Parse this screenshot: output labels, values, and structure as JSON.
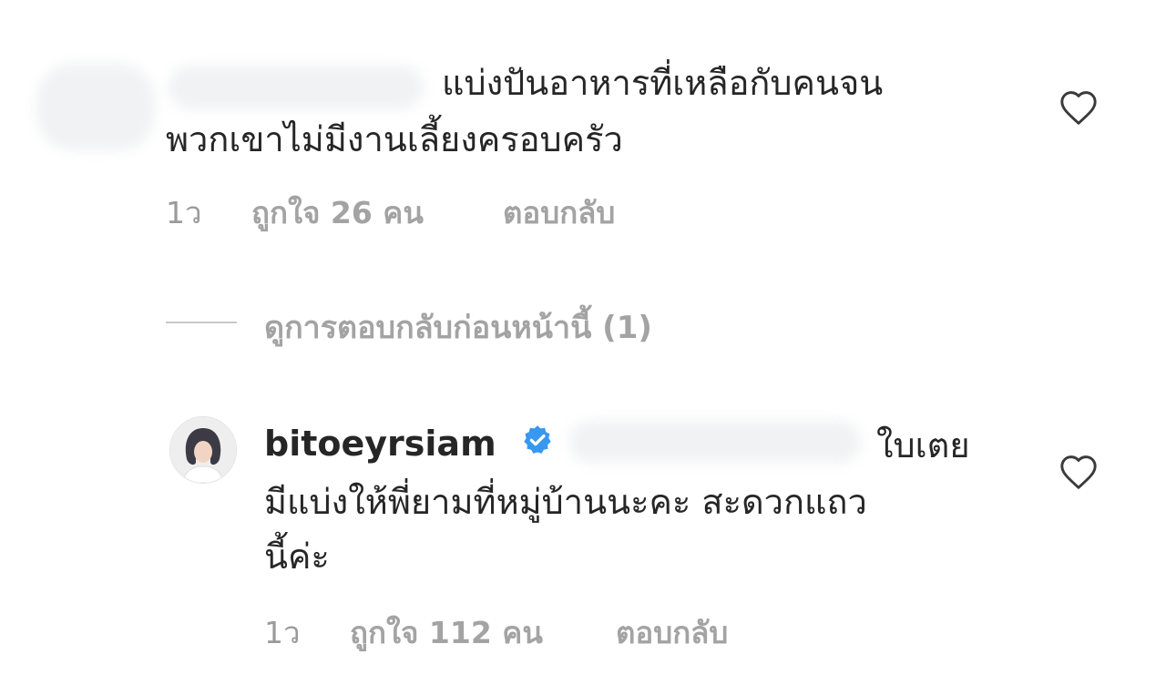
{
  "comments": [
    {
      "line1": "แบ่งปันอาหารที่เหลือกับคนจน",
      "line2": "พวกเขาไม่มีงานเลี้ยงครอบครัว",
      "time": "1ว",
      "likes": "ถูกใจ 26 คน",
      "reply": "ตอบกลับ"
    }
  ],
  "view_replies": {
    "label": "ดูการตอบกลับก่อนหน้านี้ (1)"
  },
  "reply_comment": {
    "username": "bitoeyrsiam",
    "line1": "ใบเตย",
    "line2": "มีแบ่งให้พี่ยามที่หมู่บ้านนะคะ สะดวกแถว",
    "line3": "นี้ค่ะ",
    "time": "1ว",
    "likes": "ถูกใจ 112 คน",
    "reply": "ตอบกลับ"
  },
  "icons": {
    "like": "heart-outline-icon",
    "verified": "verified-badge-icon",
    "avatar": "user-avatar"
  },
  "colors": {
    "text": "#262626",
    "meta": "#9a9a9a",
    "verified": "#3897f0"
  }
}
